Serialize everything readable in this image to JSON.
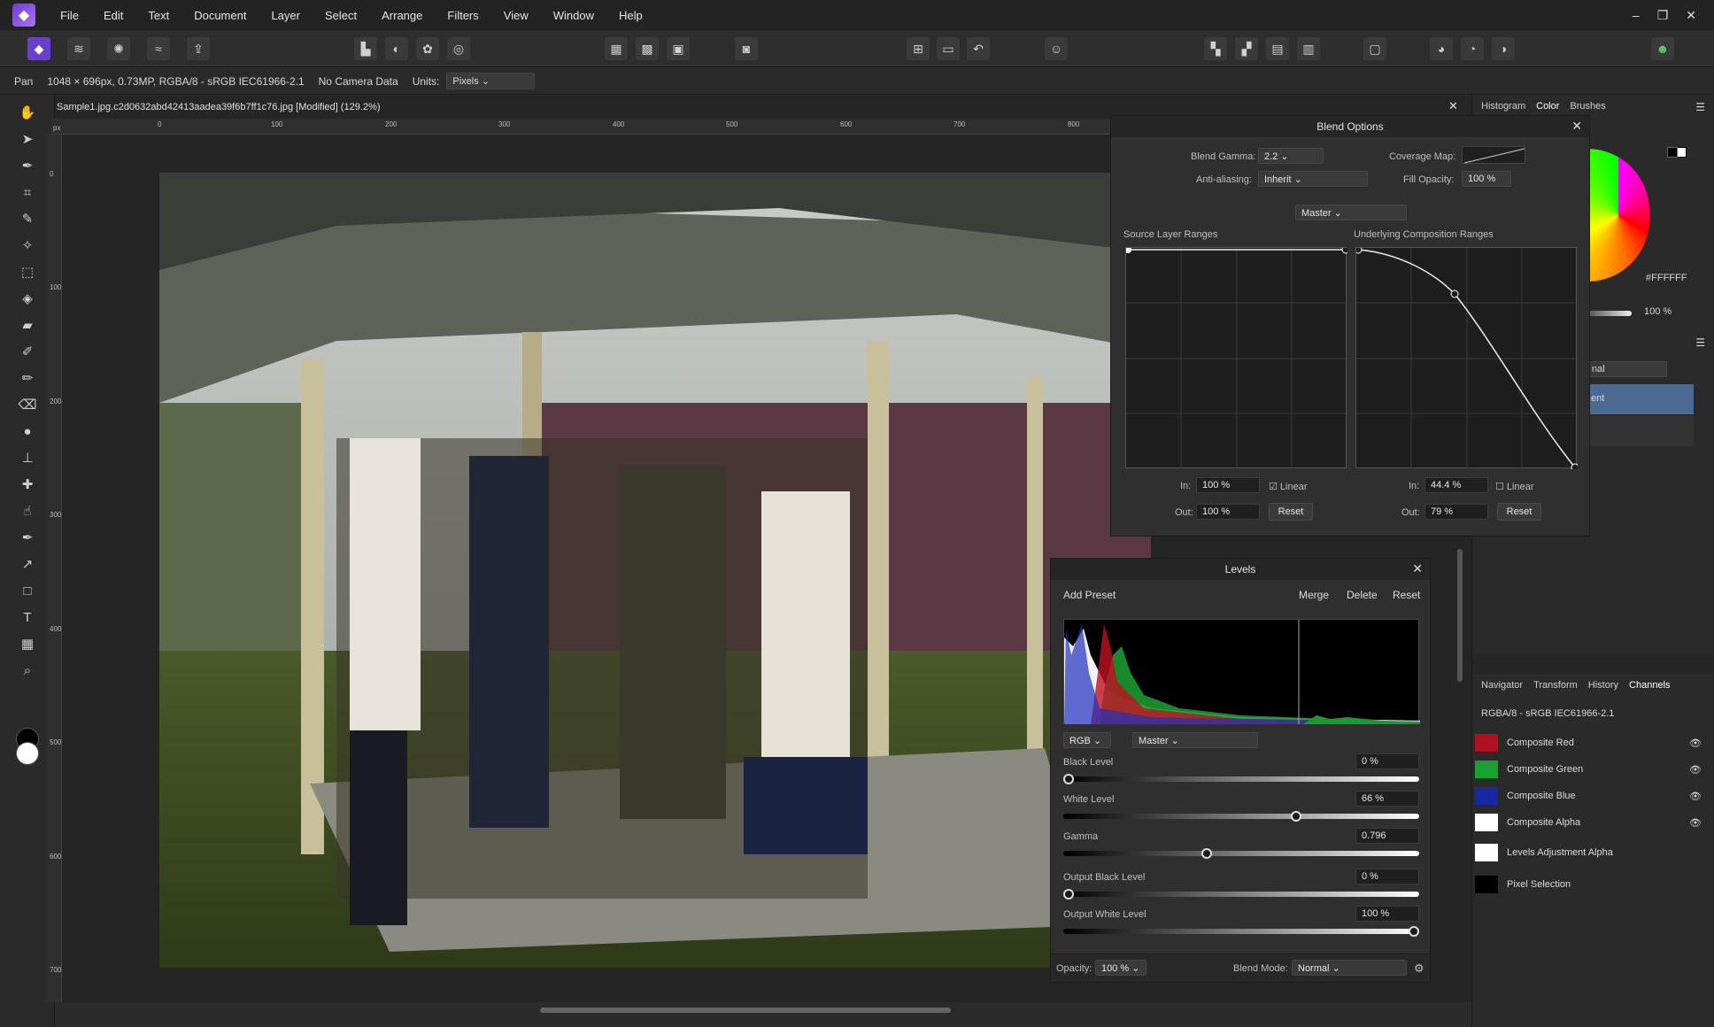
{
  "menubar": {
    "items": [
      "File",
      "Edit",
      "Text",
      "Document",
      "Layer",
      "Select",
      "Arrange",
      "Filters",
      "View",
      "Window",
      "Help"
    ],
    "window_buttons": [
      "–",
      "❐",
      "✕"
    ]
  },
  "context": {
    "tool": "Pan",
    "doc_info": "1048 × 696px, 0.73MP, RGBA/8 - sRGB IEC61966-2.1",
    "camera": "No Camera Data",
    "units_label": "Units:",
    "units_value": "Pixels"
  },
  "document": {
    "tab_title": "Sample1.jpg.c2d0632abd42413aadea39f6b7ff1c76.jpg [Modified] (129.2%)",
    "ruler_unit": "px",
    "h_ticks": [
      "0",
      "100",
      "200",
      "300",
      "400",
      "500",
      "600",
      "700",
      "800"
    ],
    "v_ticks": [
      "0",
      "100",
      "200",
      "300",
      "400",
      "500",
      "600",
      "700"
    ]
  },
  "right_tabs_top": [
    "Histogram",
    "Color",
    "Brushes"
  ],
  "color_panel": {
    "hex": "FFFFFF",
    "opacity": "100 %"
  },
  "blend_options": {
    "title": "Blend Options",
    "blend_gamma_label": "Blend Gamma:",
    "blend_gamma_value": "2.2",
    "coverage_map_label": "Coverage Map:",
    "antialias_label": "Anti-aliasing:",
    "antialias_value": "Inherit",
    "fill_opacity_label": "Fill Opacity:",
    "fill_opacity_value": "100 %",
    "channel": "Master",
    "source_label": "Source Layer Ranges",
    "underlying_label": "Underlying Composition Ranges",
    "src_in_label": "In:",
    "src_in": "100 %",
    "src_out_label": "Out:",
    "src_out": "100 %",
    "src_linear": "Linear",
    "und_in_label": "In:",
    "und_in": "44.4 %",
    "und_out_label": "Out:",
    "und_out": "79 %",
    "und_linear": "Linear",
    "reset": "Reset"
  },
  "levels": {
    "title": "Levels",
    "add_preset": "Add Preset",
    "merge": "Merge",
    "delete": "Delete",
    "reset": "Reset",
    "channel_mode": "RGB",
    "channel": "Master",
    "black_level_label": "Black Level",
    "black_level": "0 %",
    "black_level_frac": 0.0,
    "white_level_label": "White Level",
    "white_level": "66 %",
    "white_level_frac": 0.66,
    "gamma_label": "Gamma",
    "gamma": "0.796",
    "gamma_frac": 0.4,
    "out_black_label": "Output Black Level",
    "out_black": "0 %",
    "out_black_frac": 0.0,
    "out_white_label": "Output White Level",
    "out_white": "100 %",
    "out_white_frac": 1.0,
    "opacity_label": "Opacity:",
    "opacity": "100 %",
    "blend_mode_label": "Blend Mode:",
    "blend_mode": "Normal"
  },
  "layers_panel": {
    "mode_partial": "nal",
    "layer_partial": "ent"
  },
  "bottom_tabs": [
    "Navigator",
    "Transform",
    "History",
    "Channels"
  ],
  "channels": {
    "profile": "RGBA/8 - sRGB IEC61966-2.1",
    "items": [
      {
        "name": "Composite Red",
        "color": "#b01020"
      },
      {
        "name": "Composite Green",
        "color": "#18a030"
      },
      {
        "name": "Composite Blue",
        "color": "#1828a0"
      },
      {
        "name": "Composite Alpha",
        "color": "#ffffff"
      },
      {
        "name": "Levels Adjustment Alpha",
        "color": "#ffffff"
      },
      {
        "name": "Pixel Selection",
        "color": "#000000"
      }
    ]
  }
}
